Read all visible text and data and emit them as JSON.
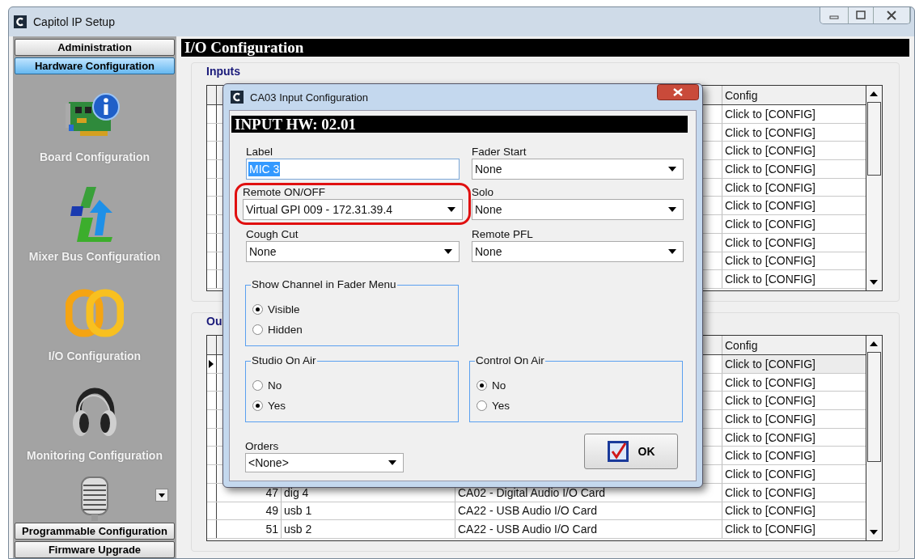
{
  "window": {
    "title": "Capitol IP Setup"
  },
  "sidebar": {
    "top_buttons": [
      {
        "label": "Administration",
        "selected": false
      },
      {
        "label": "Hardware Configuration",
        "selected": true
      }
    ],
    "items": [
      {
        "kind": "board",
        "label": "Board Configuration"
      },
      {
        "kind": "mixer",
        "label": "Mixer Bus Configuration"
      },
      {
        "kind": "io",
        "label": "I/O Configuration"
      },
      {
        "kind": "monitoring",
        "label": "Monitoring Configuration"
      },
      {
        "kind": "mic"
      }
    ],
    "bottom_buttons": [
      {
        "label": "Programmable Configuration",
        "selected": false
      },
      {
        "label": "Firmware Upgrade",
        "selected": false
      }
    ]
  },
  "page": {
    "title": "I/O Configuration"
  },
  "inputs": {
    "title": "Inputs",
    "config_header": "Config",
    "rows": [
      {
        "config": "Click to [CONFIG]"
      },
      {
        "config": "Click to [CONFIG]"
      },
      {
        "config": "Click to [CONFIG]"
      },
      {
        "config": "Click to [CONFIG]"
      },
      {
        "config": "Click to [CONFIG]"
      },
      {
        "config": "Click to [CONFIG]"
      },
      {
        "config": "Click to [CONFIG]"
      },
      {
        "config": "Click to [CONFIG]"
      },
      {
        "config": "Click to [CONFIG]"
      },
      {
        "config": "Click to [CONFIG]"
      }
    ]
  },
  "outputs": {
    "title": "Ou",
    "config_header": "Config",
    "rows": [
      {
        "selected": true,
        "config": "Click to [CONFIG]"
      },
      {
        "selected": false,
        "config": "Click to [CONFIG]"
      },
      {
        "selected": false,
        "config": "Click to [CONFIG]"
      },
      {
        "selected": false,
        "config": "Click to [CONFIG]"
      },
      {
        "selected": false,
        "config": "Click to [CONFIG]"
      },
      {
        "selected": false,
        "config": "Click to [CONFIG]"
      },
      {
        "selected": false,
        "config": "Click to [CONFIG]"
      },
      {
        "selected": false,
        "number": "47",
        "name": "dig 4",
        "card": "CA02 - Digital Audio I/O Card",
        "config": "Click to [CONFIG]"
      },
      {
        "selected": false,
        "number": "49",
        "name": "usb 1",
        "card": "CA22 - USB Audio I/O Card",
        "config": "Click to [CONFIG]"
      },
      {
        "selected": false,
        "number": "51",
        "name": "usb 2",
        "card": "CA22 - USB Audio I/O Card",
        "config": "Click to [CONFIG]"
      }
    ]
  },
  "dialog": {
    "title": "CA03 Input Configuration",
    "header": "INPUT HW: 02.01",
    "fields": [
      {
        "kind": "text",
        "label": "Label",
        "value": "MIC 3",
        "text_selected": true,
        "highlighted": false
      },
      {
        "kind": "dropdown",
        "label": "Fader Start",
        "value": "None",
        "highlighted": false
      },
      {
        "kind": "dropdown",
        "label": "Remote ON/OFF",
        "value": "Virtual GPI 009 - 172.31.39.4",
        "highlighted": true
      },
      {
        "kind": "dropdown",
        "label": "Solo",
        "value": "None",
        "highlighted": false
      },
      {
        "kind": "dropdown",
        "label": "Cough Cut",
        "value": "None",
        "highlighted": false
      },
      {
        "kind": "dropdown",
        "label": "Remote PFL",
        "value": "None",
        "highlighted": false
      }
    ],
    "groups": [
      {
        "title": "Show Channel in Fader Menu",
        "options": [
          {
            "label": "Visible",
            "selected": true
          },
          {
            "label": "Hidden",
            "selected": false
          }
        ]
      },
      {
        "title": "Studio On Air",
        "options": [
          {
            "label": "No",
            "selected": false
          },
          {
            "label": "Yes",
            "selected": true
          }
        ]
      },
      {
        "title": "Control On Air",
        "options": [
          {
            "label": "No",
            "selected": true
          },
          {
            "label": "Yes",
            "selected": false
          }
        ]
      }
    ],
    "orders": {
      "label": "Orders",
      "value": "<None>"
    },
    "ok_button": "OK"
  }
}
